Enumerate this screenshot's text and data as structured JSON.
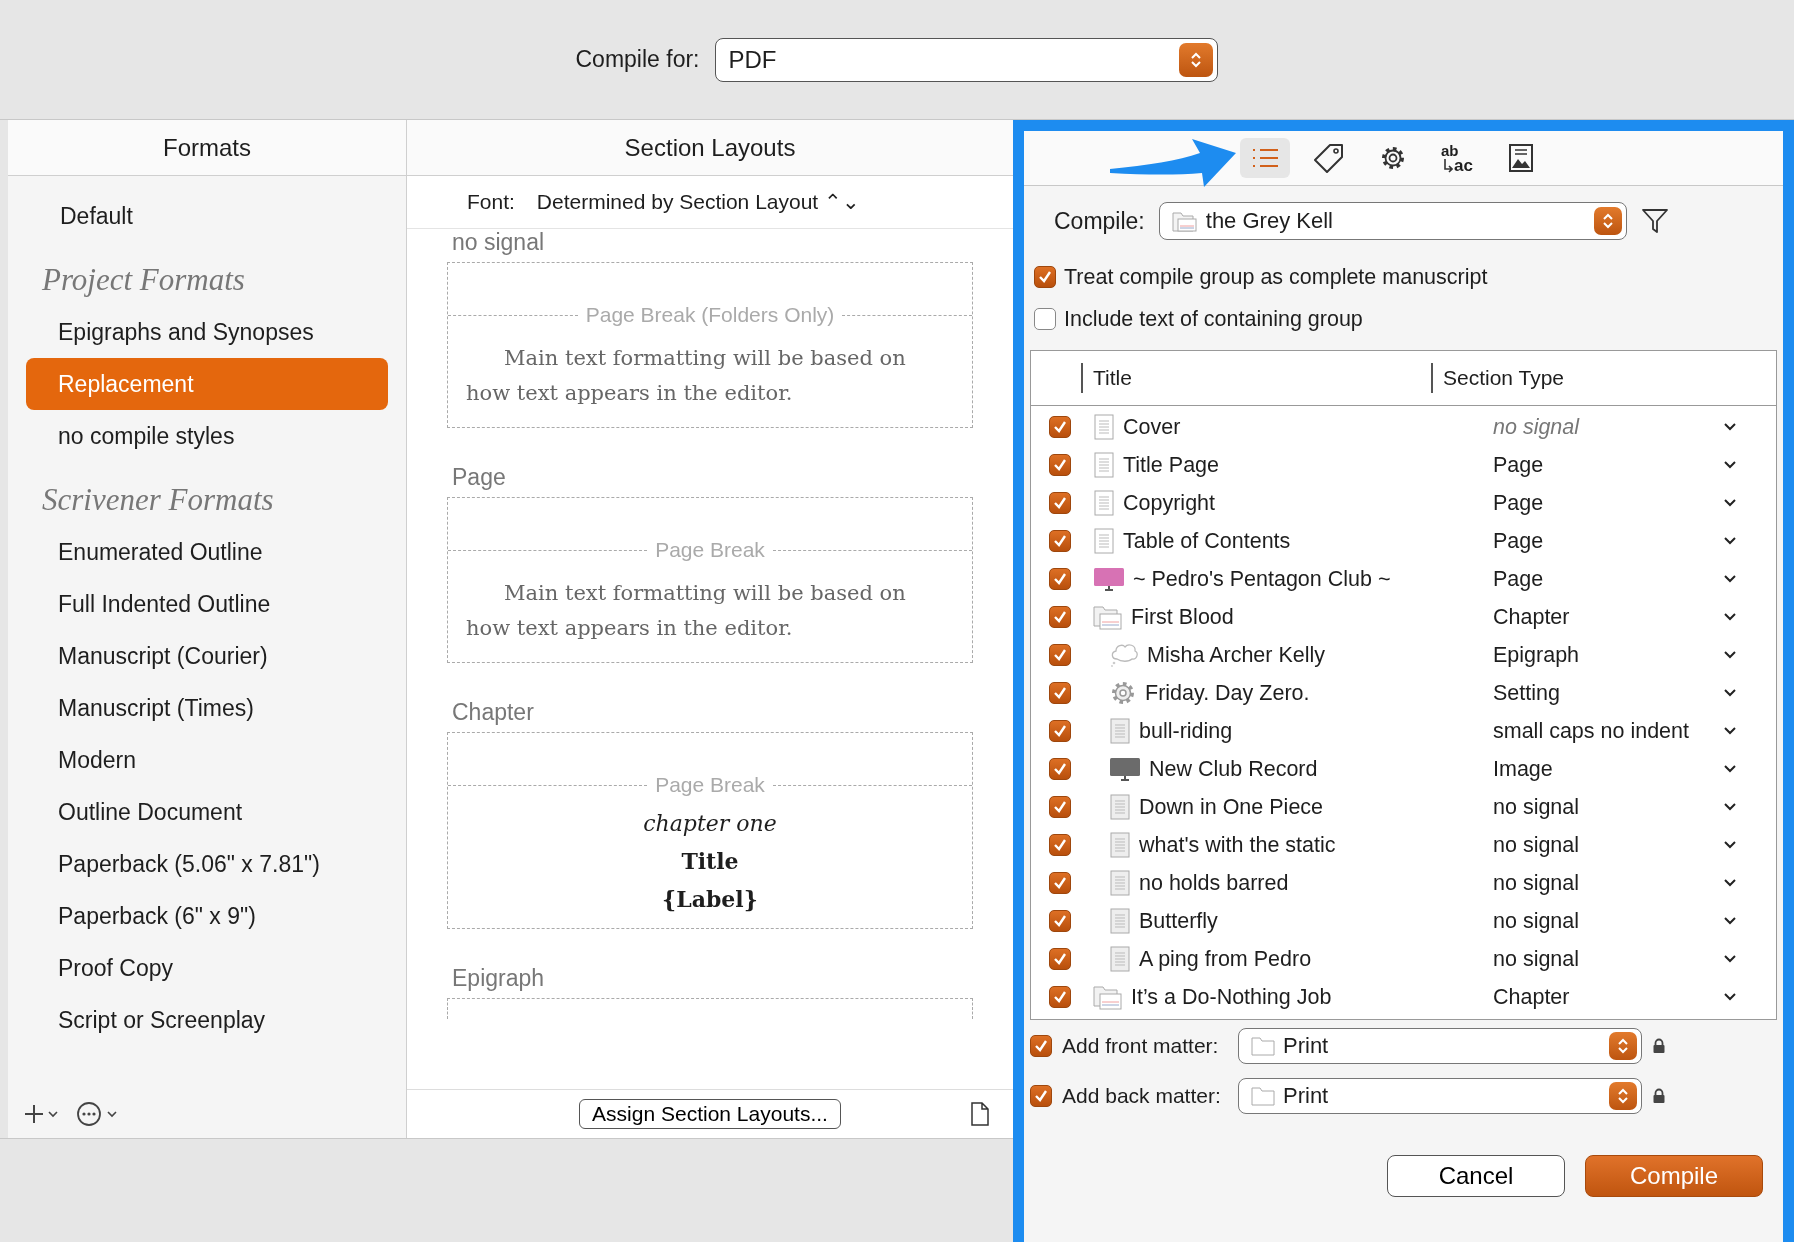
{
  "compile_for": {
    "label": "Compile for:",
    "value": "PDF"
  },
  "formats": {
    "title": "Formats",
    "items": [
      {
        "kind": "item",
        "label": "Default",
        "selected": false
      },
      {
        "kind": "heading",
        "label": "Project Formats"
      },
      {
        "kind": "subitem",
        "label": "Epigraphs and Synopses",
        "selected": false
      },
      {
        "kind": "subitem",
        "label": "Replacement",
        "selected": true
      },
      {
        "kind": "subitem",
        "label": "no compile styles",
        "selected": false
      },
      {
        "kind": "heading",
        "label": "Scrivener Formats"
      },
      {
        "kind": "subitem",
        "label": "Enumerated Outline",
        "selected": false
      },
      {
        "kind": "subitem",
        "label": "Full Indented Outline",
        "selected": false
      },
      {
        "kind": "subitem",
        "label": "Manuscript (Courier)",
        "selected": false
      },
      {
        "kind": "subitem",
        "label": "Manuscript (Times)",
        "selected": false
      },
      {
        "kind": "subitem",
        "label": "Modern",
        "selected": false
      },
      {
        "kind": "subitem",
        "label": "Outline Document",
        "selected": false
      },
      {
        "kind": "subitem",
        "label": "Paperback (5.06\" x 7.81\")",
        "selected": false
      },
      {
        "kind": "subitem",
        "label": "Paperback (6\" x 9\")",
        "selected": false
      },
      {
        "kind": "subitem",
        "label": "Proof Copy",
        "selected": false
      },
      {
        "kind": "subitem",
        "label": "Script or Screenplay",
        "selected": false
      }
    ]
  },
  "section_layouts": {
    "title": "Section Layouts",
    "font_label": "Font:",
    "font_value": "Determined by Section Layout ⌃⌄",
    "layouts": [
      {
        "kind": "text",
        "name": "no signal",
        "break": "Page Break (Folders Only)",
        "text": "Main text formatting will be based on how text appears in the editor."
      },
      {
        "kind": "text",
        "name": "Page",
        "break": "Page Break",
        "text": "Main text formatting will be based on how text appears in the editor."
      },
      {
        "kind": "title",
        "name": "Chapter",
        "break": "Page Break",
        "lines": [
          {
            "kind": "subtitle",
            "text": "chapter one"
          },
          {
            "kind": "title",
            "text": "Title"
          },
          {
            "kind": "label",
            "text": "{Label}"
          }
        ]
      },
      {
        "kind": "partial",
        "name": "Epigraph"
      }
    ],
    "assign_button": "Assign Section Layouts..."
  },
  "toolbar": [
    {
      "kind": "list",
      "selected": true
    },
    {
      "kind": "tag",
      "selected": false
    },
    {
      "kind": "gear",
      "selected": false
    },
    {
      "kind": "replace",
      "top": "ab",
      "bottom": "ac",
      "selected": false
    },
    {
      "kind": "image",
      "selected": false
    }
  ],
  "compile": {
    "label": "Compile:",
    "value": "the Grey Kell"
  },
  "options": [
    {
      "label": "Treat compile group as complete manuscript",
      "checked": true
    },
    {
      "label": "Include text of containing group",
      "checked": false
    }
  ],
  "table": {
    "columns": [
      "Title",
      "Section Type"
    ],
    "rows": [
      {
        "title": "Cover",
        "kind": "document",
        "type": "no signal",
        "inherited": true,
        "checked": true
      },
      {
        "title": "Title Page",
        "kind": "document",
        "type": "Page",
        "inherited": false,
        "checked": true
      },
      {
        "title": "Copyright",
        "kind": "document",
        "type": "Page",
        "inherited": false,
        "checked": true
      },
      {
        "title": "Table of Contents",
        "kind": "document",
        "type": "Page",
        "inherited": false,
        "checked": true
      },
      {
        "title": "~ Pedro's Pentagon Club ~",
        "kind": "monitor",
        "color": "#d772b4",
        "type": "Page",
        "inherited": false,
        "checked": true
      },
      {
        "title": "First Blood",
        "kind": "folder",
        "type": "Chapter",
        "inherited": false,
        "checked": true,
        "children": [
          {
            "title": "Misha Archer Kelly",
            "kind": "cloud",
            "type": "Epigraph",
            "inherited": false,
            "checked": true
          },
          {
            "title": "Friday. Day Zero.",
            "kind": "gear",
            "type": "Setting",
            "inherited": false,
            "checked": true
          },
          {
            "title": "bull-riding",
            "kind": "document",
            "type": "small caps no indent",
            "inherited": false,
            "checked": true
          },
          {
            "title": "New Club Record",
            "kind": "monitor",
            "color": "#6b6b6b",
            "type": "Image",
            "inherited": false,
            "checked": true
          },
          {
            "title": "Down in One Piece",
            "kind": "document",
            "type": "no signal",
            "inherited": false,
            "checked": true
          },
          {
            "title": "what's with the static",
            "kind": "document",
            "type": "no signal",
            "inherited": false,
            "checked": true
          },
          {
            "title": "no holds barred",
            "kind": "document",
            "type": "no signal",
            "inherited": false,
            "checked": true
          },
          {
            "title": "Butterfly",
            "kind": "document",
            "type": "no signal",
            "inherited": false,
            "checked": true
          },
          {
            "title": "A ping from Pedro",
            "kind": "document",
            "type": "no signal",
            "inherited": false,
            "checked": true
          }
        ]
      },
      {
        "title": "It’s a Do-Nothing Job",
        "kind": "folder",
        "type": "Chapter",
        "inherited": false,
        "checked": true
      }
    ]
  },
  "matter": [
    {
      "label": "Add front matter:",
      "value": "Print",
      "checked": true
    },
    {
      "label": "Add back matter:",
      "value": "Print",
      "checked": true
    }
  ],
  "buttons": [
    {
      "label": "Cancel",
      "kind": "normal"
    },
    {
      "label": "Compile",
      "kind": "default"
    }
  ]
}
